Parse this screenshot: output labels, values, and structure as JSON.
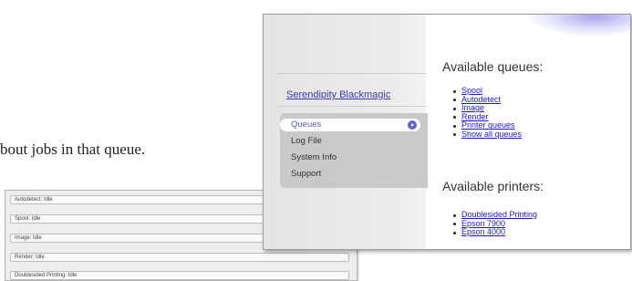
{
  "document": {
    "text_fragment": "bout jobs in that queue."
  },
  "status_panel": {
    "rows": [
      "Autodetect: Idle",
      "Spool: Idle",
      "Image: Idle",
      "Render: Idle",
      "Doublesided Printing: Idle"
    ]
  },
  "server_window": {
    "sidebar": {
      "hostname": "Serendipity Blackmagic",
      "nav_items": [
        "Queues",
        "Log File",
        "System Info",
        "Support"
      ],
      "active_item": "Queues",
      "active_arrow_icon": "chevron-right-circle-icon",
      "accent_color": "#5b5bd0"
    },
    "main": {
      "queues_heading": "Available queues:",
      "queues": [
        "Spool",
        "Autodetect",
        "Image",
        "Render",
        "Printer queues",
        "Show all queues"
      ],
      "printers_heading": "Available printers:",
      "printers": [
        "Doublesided Printing",
        "Epson 7900",
        "Epson 4000"
      ],
      "link_color": "#1a1ad6"
    }
  }
}
